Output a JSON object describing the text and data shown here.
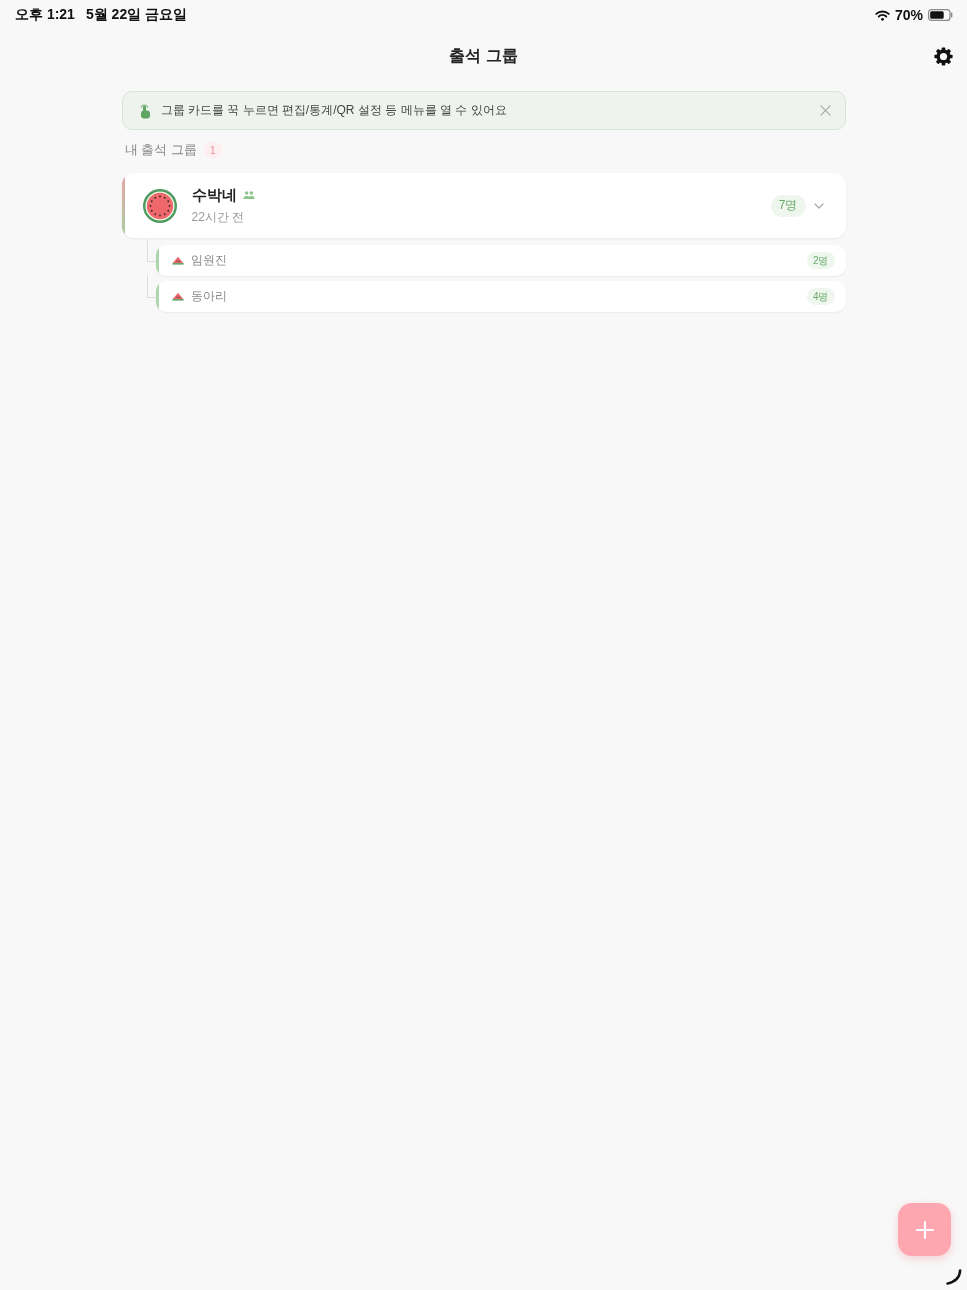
{
  "status_bar": {
    "time": "오후 1:21",
    "date": "5월 22일 금요일",
    "battery": "70%"
  },
  "header": {
    "title": "출석 그룹"
  },
  "tip_banner": {
    "text": "그룹 카드를 꾹 누르면 편집/통계/QR 설정 등 메뉴를 열 수 있어요"
  },
  "section": {
    "title": "내 출석 그룹",
    "count": "1"
  },
  "groups": [
    {
      "name": "수박네",
      "updated": "22시간 전",
      "members": "7명",
      "expanded": true,
      "children": [
        {
          "name": "임원진",
          "members": "2명"
        },
        {
          "name": "동아리",
          "members": "4명"
        }
      ]
    }
  ]
}
